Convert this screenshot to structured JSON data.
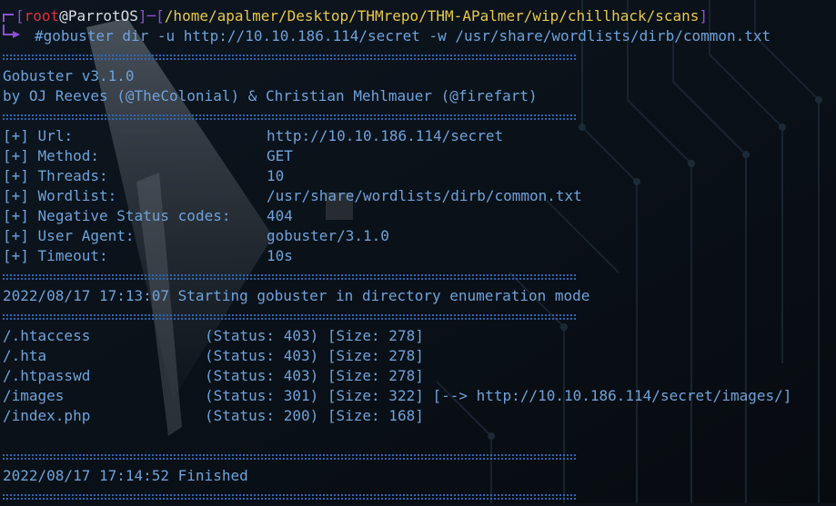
{
  "prompt": {
    "user": "root",
    "at": "@",
    "host": "ParrotOS",
    "dash": "─",
    "path": "/home/apalmer/Desktop/THMrepo/THM-APalmer/wip/chillhack/scans",
    "command": "#gobuster dir -u http://10.10.186.114/secret -w /usr/share/wordlists/dirb/common.txt"
  },
  "banner": {
    "title": "Gobuster v3.1.0",
    "credits": "by OJ Reeves (@TheColonial) & Christian Mehlmauer (@firefart)"
  },
  "config": [
    {
      "prefix": "[+]",
      "key": "Url:",
      "value": "http://10.10.186.114/secret"
    },
    {
      "prefix": "[+]",
      "key": "Method:",
      "value": "GET"
    },
    {
      "prefix": "[+]",
      "key": "Threads:",
      "value": "10"
    },
    {
      "prefix": "[+]",
      "key": "Wordlist:",
      "value": "/usr/share/wordlists/dirb/common.txt"
    },
    {
      "prefix": "[+]",
      "key": "Negative Status codes:",
      "value": "404"
    },
    {
      "prefix": "[+]",
      "key": "User Agent:",
      "value": "gobuster/3.1.0"
    },
    {
      "prefix": "[+]",
      "key": "Timeout:",
      "value": "10s"
    }
  ],
  "start_message": "2022/08/17 17:13:07 Starting gobuster in directory enumeration mode",
  "results": [
    {
      "path": "/.htaccess",
      "status": "(Status: 403)",
      "size": "[Size: 278]",
      "redirect": ""
    },
    {
      "path": "/.hta",
      "status": "(Status: 403)",
      "size": "[Size: 278]",
      "redirect": ""
    },
    {
      "path": "/.htpasswd",
      "status": "(Status: 403)",
      "size": "[Size: 278]",
      "redirect": ""
    },
    {
      "path": "/images",
      "status": "(Status: 301)",
      "size": "[Size: 322]",
      "redirect": "[--> http://10.10.186.114/secret/images/]"
    },
    {
      "path": "/index.php",
      "status": "(Status: 200)",
      "size": "[Size: 168]",
      "redirect": ""
    }
  ],
  "finish_message": "2022/08/17 17:14:52 Finished",
  "colors": {
    "background": "#0b1117",
    "prompt_frame": "#8e4fd0",
    "user": "#e0303a",
    "path": "#e8c84a",
    "command": "#6fa2d9",
    "separator": "#2f66b5",
    "output_text": "#aeb8c4"
  }
}
